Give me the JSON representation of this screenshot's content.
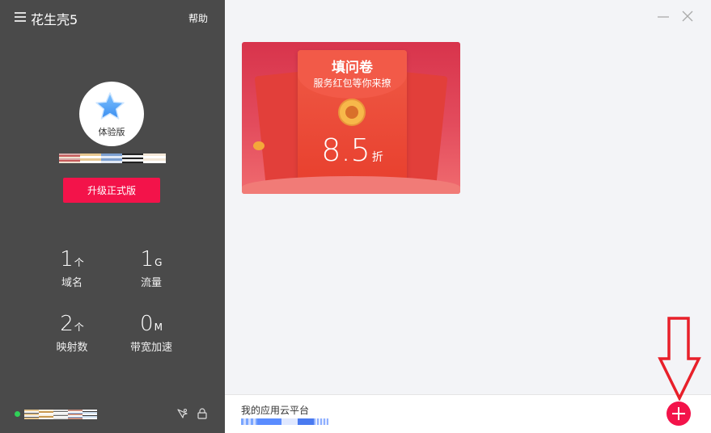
{
  "app": {
    "title": "花生壳5",
    "help_label": "帮助"
  },
  "profile": {
    "edition_label": "体验版",
    "upgrade_label": "升级正式版"
  },
  "stats": [
    {
      "value": "1",
      "unit": "个",
      "label": "域名"
    },
    {
      "value": "1",
      "unit": "G",
      "label": "流量"
    },
    {
      "value": "2",
      "unit": "个",
      "label": "映射数"
    },
    {
      "value": "0",
      "unit": "M",
      "label": "带宽加速"
    }
  ],
  "banner": {
    "title": "填问卷",
    "subtitle": "服务红包等你来撩",
    "discount_value": "8.5",
    "discount_suffix": "折"
  },
  "bottom": {
    "label": "我的应用云平台"
  },
  "colors": {
    "sidebar_bg": "#4a4a4a",
    "accent": "#f3134a",
    "online": "#30d158",
    "annotation": "#e8202a"
  },
  "icons": {
    "menu": "hamburger-icon",
    "star": "star-icon",
    "remote": "remote-desktop-icon",
    "lock": "lock-icon",
    "minimize": "minimize-icon",
    "close": "close-icon",
    "add": "plus-icon"
  }
}
